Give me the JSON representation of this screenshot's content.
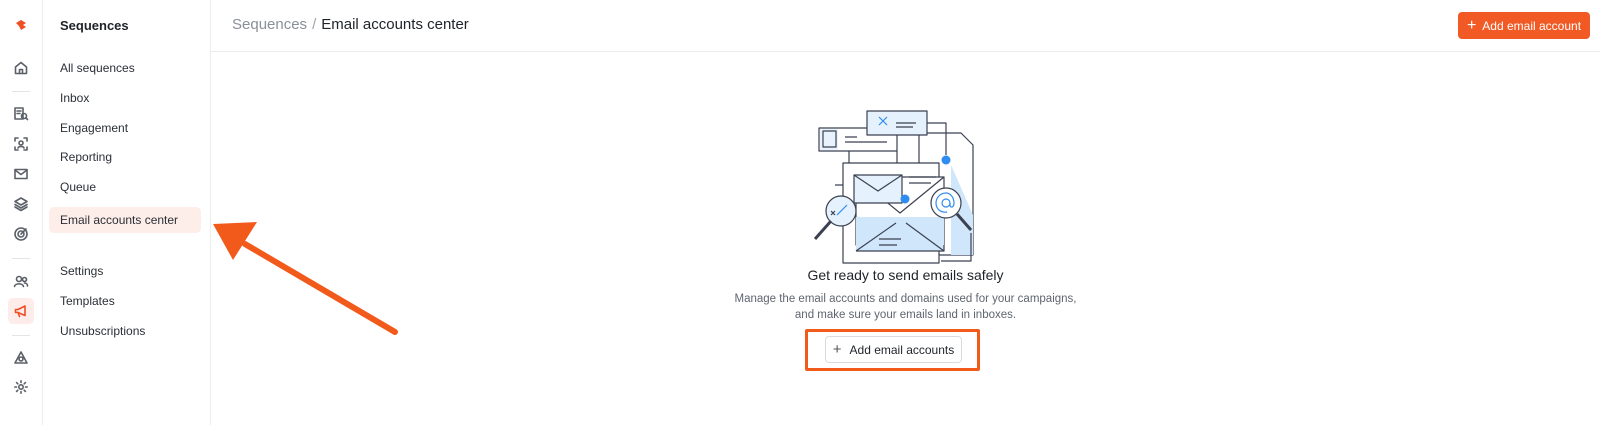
{
  "rail": {
    "icons": [
      "logo-icon",
      "home-icon",
      "prospect-search-icon",
      "contacts-icon",
      "mail-check-icon",
      "layers-icon",
      "target-icon",
      "people-icon",
      "megaphone-icon",
      "network-icon",
      "settings-icon"
    ]
  },
  "sidebar": {
    "heading": "Sequences",
    "items": [
      {
        "label": "All sequences"
      },
      {
        "label": "Inbox"
      },
      {
        "label": "Engagement"
      },
      {
        "label": "Reporting"
      },
      {
        "label": "Queue"
      },
      {
        "label": "Email accounts center",
        "active": true
      },
      {
        "label": "Settings"
      },
      {
        "label": "Templates"
      },
      {
        "label": "Unsubscriptions"
      }
    ]
  },
  "header": {
    "breadcrumb_parent": "Sequences",
    "separator": "/",
    "breadcrumb_current": "Email accounts center",
    "primary_button": "Add email account"
  },
  "empty_state": {
    "title": "Get ready to send emails safely",
    "description_line1": "Manage the email accounts and domains used for your campaigns,",
    "description_line2": "and make sure your emails land in inboxes.",
    "button": "Add email accounts"
  },
  "colors": {
    "accent": "#f15a24",
    "highlight": "#f25a1c",
    "active_bg": "#fdeeea"
  }
}
